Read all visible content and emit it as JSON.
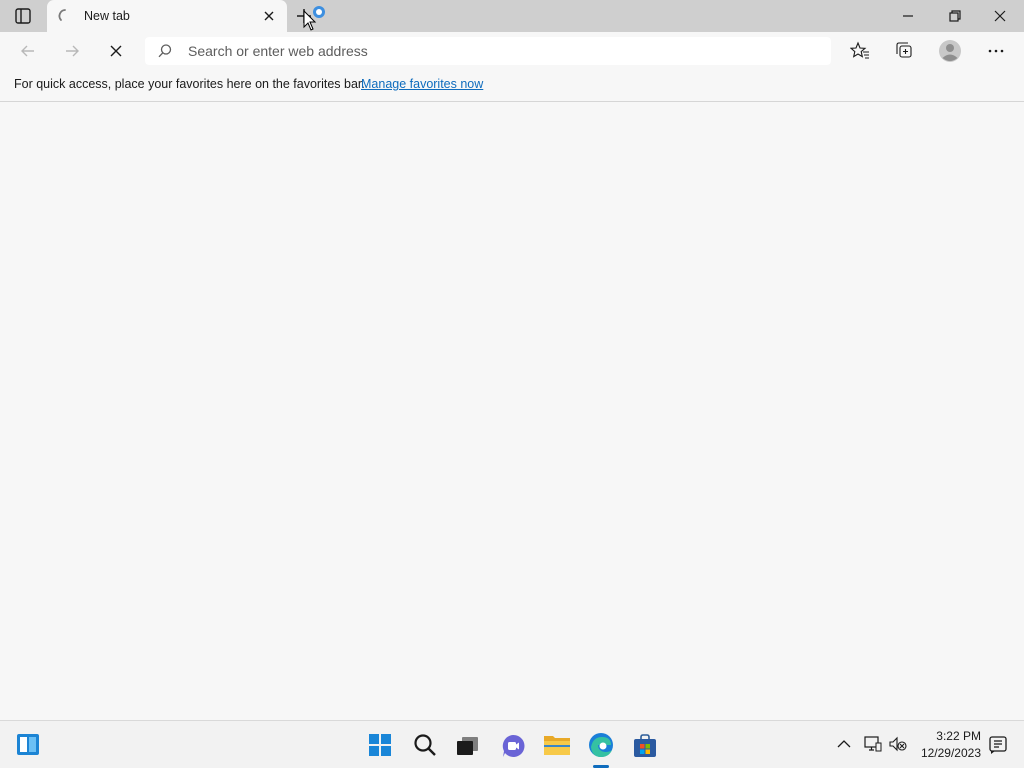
{
  "browser": {
    "tab": {
      "title": "New tab"
    },
    "address_bar": {
      "placeholder": "Search or enter web address",
      "value": ""
    },
    "favorites_bar": {
      "message": "For quick access, place your favorites here on the favorites bar.",
      "link": "Manage favorites now"
    }
  },
  "taskbar": {
    "time": "3:22 PM",
    "date": "12/29/2023"
  },
  "colors": {
    "accent": "#0f6cbd",
    "titlebar": "#cfcfcf",
    "background": "#f7f7f7"
  }
}
